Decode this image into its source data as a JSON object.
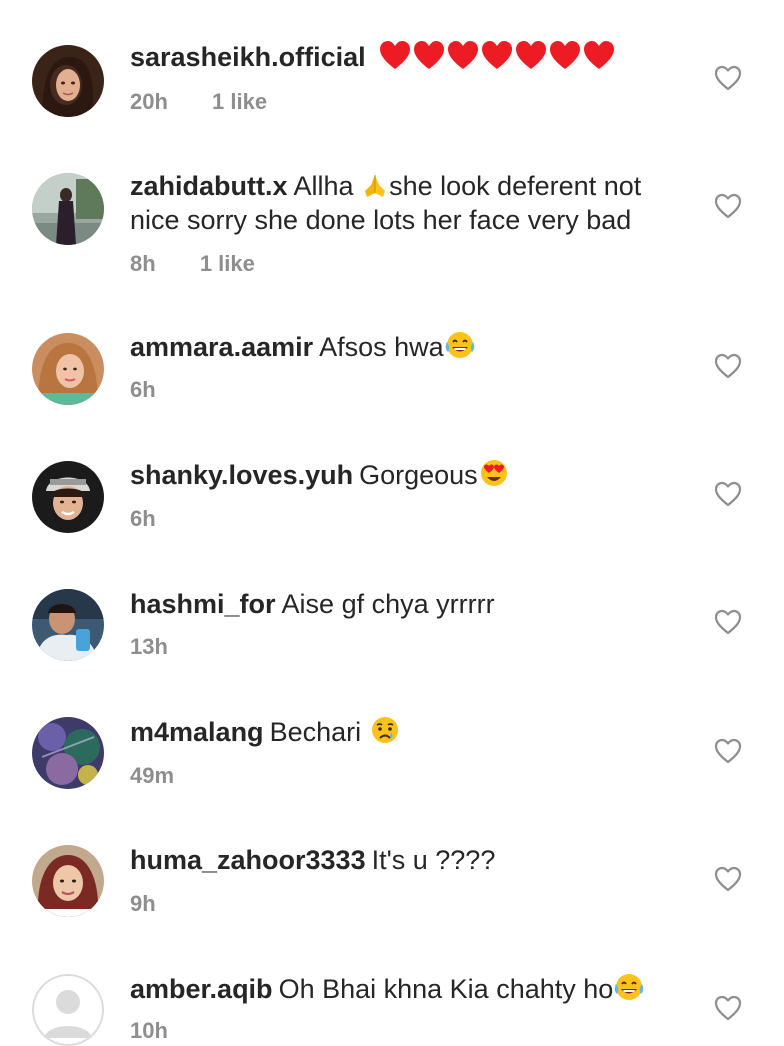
{
  "comments": [
    {
      "username": "sarasheikh.official",
      "text": "",
      "time": "20h",
      "likes": "1 like",
      "avatar_icon": "avatar-woman-dark-hair",
      "emoji": "❤️❤️❤️❤️❤️❤️❤️"
    },
    {
      "username": "zahidabutt.x",
      "text_before": "Allha ",
      "text_after": "she look deferent not nice sorry she done lots her face very bad",
      "time": "8h",
      "likes": "1 like",
      "avatar_icon": "avatar-person-standing",
      "emoji": "🙏"
    },
    {
      "username": "ammara.aamir",
      "text": "Afsos hwa",
      "time": "6h",
      "likes": "",
      "avatar_icon": "avatar-woman-blonde",
      "emoji": "😂"
    },
    {
      "username": "shanky.loves.yuh",
      "text": "Gorgeous",
      "time": "6h",
      "likes": "",
      "avatar_icon": "avatar-man-cap",
      "emoji": "😍"
    },
    {
      "username": "hashmi_for",
      "text": "Aise gf chya yrrrrr",
      "time": "13h",
      "likes": "",
      "avatar_icon": "avatar-man-selfie",
      "emoji": ""
    },
    {
      "username": "m4malang",
      "text": "Bechari ",
      "time": "49m",
      "likes": "",
      "avatar_icon": "avatar-abstract-purple",
      "emoji": "😢"
    },
    {
      "username": "huma_zahoor3333",
      "text": "It's u ????",
      "time": "9h",
      "likes": "",
      "avatar_icon": "avatar-woman-curly-hair",
      "emoji": ""
    },
    {
      "username": "amber.aqib",
      "text": "Oh Bhai khna Kia chahty ho",
      "time": "10h",
      "likes": "",
      "avatar_icon": "avatar-default-placeholder",
      "emoji": "😂"
    }
  ],
  "colors": {
    "text": "#262626",
    "meta": "#8e8e8e",
    "heart_red": "#ed1c24",
    "like_outline": "#8e8e8e"
  }
}
